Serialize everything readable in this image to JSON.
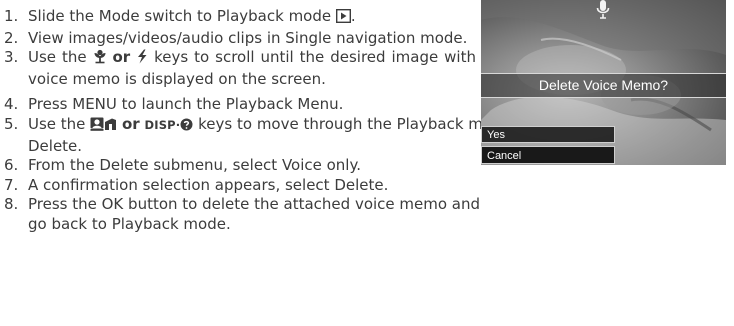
{
  "steps": [
    {
      "num": "1.",
      "pre": "Slide the Mode switch to Playback mode"
    },
    {
      "num": "2.",
      "text": "View images/videos/audio clips in Single navigation mode."
    },
    {
      "num": "3.",
      "pre": "Use the",
      "mid": "or",
      "post": "keys to scroll until the desired image with voice memo is displayed on the screen."
    },
    {
      "num": "4.",
      "text": "Press MENU to launch the Playback Menu."
    },
    {
      "num": "5.",
      "pre": "Use the",
      "mid": "or",
      "disp": "DISP·",
      "post": "keys to move through the Playback menu selections then select Delete."
    },
    {
      "num": "6.",
      "text": "From the Delete submenu, select Voice only."
    },
    {
      "num": "7.",
      "text": "A confirmation selection appears, select Delete."
    },
    {
      "num": "8.",
      "text": "Press the OK button to delete the attached voice memo and go back to Playback mode."
    }
  ],
  "screen": {
    "prompt": "Delete Voice Memo?",
    "options": [
      "Yes",
      "Cancel"
    ]
  },
  "icons": {
    "playback": "playback-icon",
    "macro": "macro-flower-icon",
    "flash": "flash-icon",
    "face": "face-detect-icon",
    "scene": "scene-mode-icon",
    "help": "help-icon",
    "mic": "microphone-icon"
  },
  "colors": {
    "text": "#3c3c3c",
    "menu_bg": "#141414",
    "menu_border": "#cfcfcf"
  }
}
